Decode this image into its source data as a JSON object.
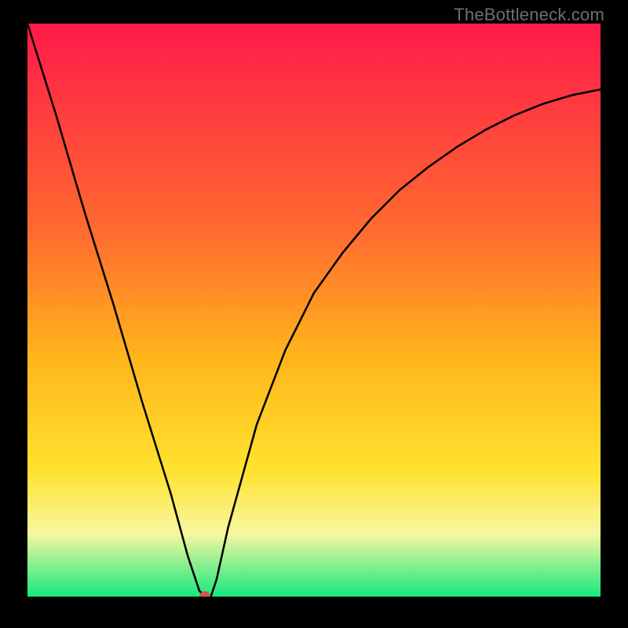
{
  "watermark": "TheBottleneck.com",
  "colors": {
    "top": "#ff1a4a",
    "mid1": "#ff6a2f",
    "mid2": "#ffb41c",
    "mid3": "#ffe22e",
    "band": "#f7f7a1",
    "bottom": "#17e87d",
    "dot": "#ce5948",
    "frame": "#000000",
    "curve": "#000000"
  },
  "chart_data": {
    "type": "line",
    "title": "",
    "xlabel": "",
    "ylabel": "",
    "xlim": [
      0,
      100
    ],
    "ylim": [
      0,
      100
    ],
    "series": [
      {
        "name": "bottleneck-curve",
        "x": [
          0,
          5,
          10,
          15,
          20,
          25,
          28,
          30,
          31,
          32,
          33,
          35,
          40,
          45,
          50,
          55,
          60,
          65,
          70,
          75,
          80,
          85,
          90,
          95,
          100
        ],
        "y": [
          100,
          84,
          67,
          51,
          34,
          18,
          7,
          1,
          0,
          0,
          3,
          12,
          30,
          43,
          53,
          60,
          66,
          71,
          75,
          78.5,
          81.5,
          84,
          86,
          87.5,
          88.5
        ]
      }
    ],
    "marker": {
      "x": 31,
      "y": 0
    },
    "gradient_stops": [
      {
        "pct": 0,
        "key": "top"
      },
      {
        "pct": 36,
        "key": "mid1"
      },
      {
        "pct": 58,
        "key": "mid2"
      },
      {
        "pct": 78,
        "key": "mid3"
      },
      {
        "pct": 89,
        "key": "band"
      },
      {
        "pct": 100,
        "key": "bottom"
      }
    ]
  }
}
